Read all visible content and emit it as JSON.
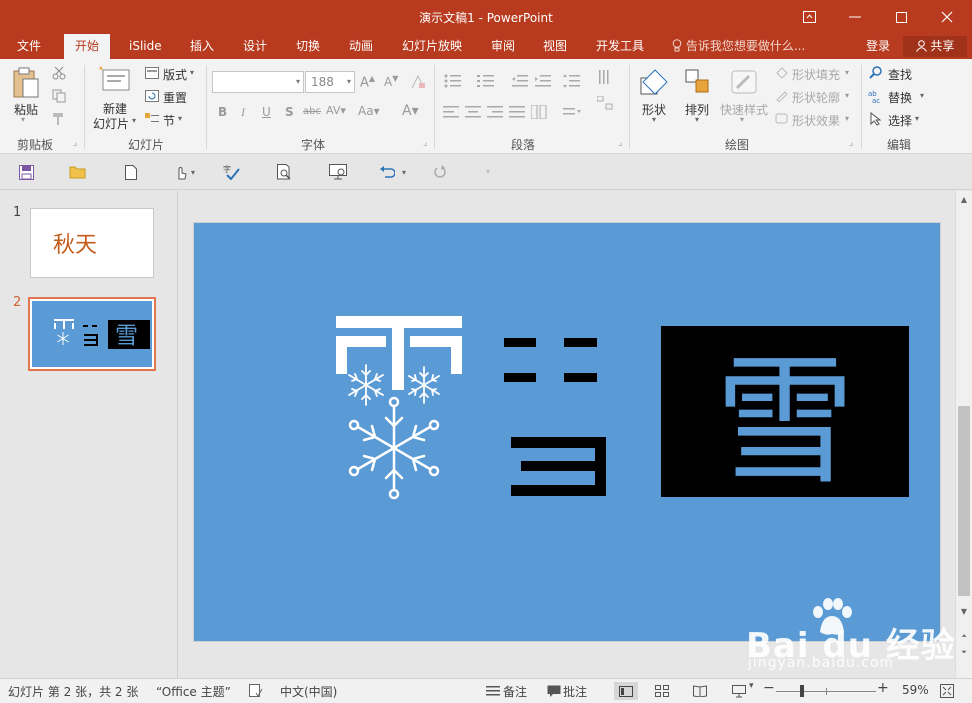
{
  "window": {
    "title": "演示文稿1 - PowerPoint",
    "controls": [
      "restore-ribbon",
      "minimize",
      "maximize",
      "close"
    ]
  },
  "ribbon_tabs": [
    {
      "label": "文件",
      "active": false
    },
    {
      "label": "开始",
      "active": true
    },
    {
      "label": "iSlide",
      "active": false
    },
    {
      "label": "插入",
      "active": false
    },
    {
      "label": "设计",
      "active": false
    },
    {
      "label": "切换",
      "active": false
    },
    {
      "label": "动画",
      "active": false
    },
    {
      "label": "幻灯片放映",
      "active": false
    },
    {
      "label": "审阅",
      "active": false
    },
    {
      "label": "视图",
      "active": false
    },
    {
      "label": "开发工具",
      "active": false
    }
  ],
  "tell_me": "告诉我您想要做什么...",
  "account": {
    "login": "登录",
    "share": "共享"
  },
  "groups": {
    "clipboard": {
      "label": "剪贴板",
      "paste": "粘贴"
    },
    "slides": {
      "label": "幻灯片",
      "new_slide_line1": "新建",
      "new_slide_line2": "幻灯片",
      "layout": "版式",
      "reset": "重置",
      "section": "节"
    },
    "font": {
      "label": "字体",
      "font_name": "",
      "font_size": "188"
    },
    "paragraph": {
      "label": "段落"
    },
    "drawing": {
      "label": "绘图",
      "shapes": "形状",
      "arrange": "排列",
      "quick_styles": "快速样式",
      "shape_fill": "形状填充",
      "shape_outline": "形状轮廓",
      "shape_effects": "形状效果"
    },
    "editing": {
      "label": "编辑",
      "find": "查找",
      "replace": "替换",
      "select": "选择"
    }
  },
  "slides": [
    {
      "number": "1",
      "text": "秋天",
      "selected": false
    },
    {
      "number": "2",
      "text": "雪",
      "selected": true
    }
  ],
  "current_slide": {
    "glyph_main": "雪",
    "background": "#5b9bd5"
  },
  "statusbar": {
    "slide_info": "幻灯片 第 2 张，共 2 张",
    "theme": "“Office 主题”",
    "language": "中文(中国)",
    "notes": "备注",
    "comments": "批注",
    "zoom": "59%"
  },
  "watermark": {
    "brand": "Bai du 经验",
    "url": "jingyan.baidu.com"
  },
  "colors": {
    "accent": "#b83b1f",
    "slide_bg": "#5b9bd5",
    "thumb_selected_border": "#e0764f"
  }
}
